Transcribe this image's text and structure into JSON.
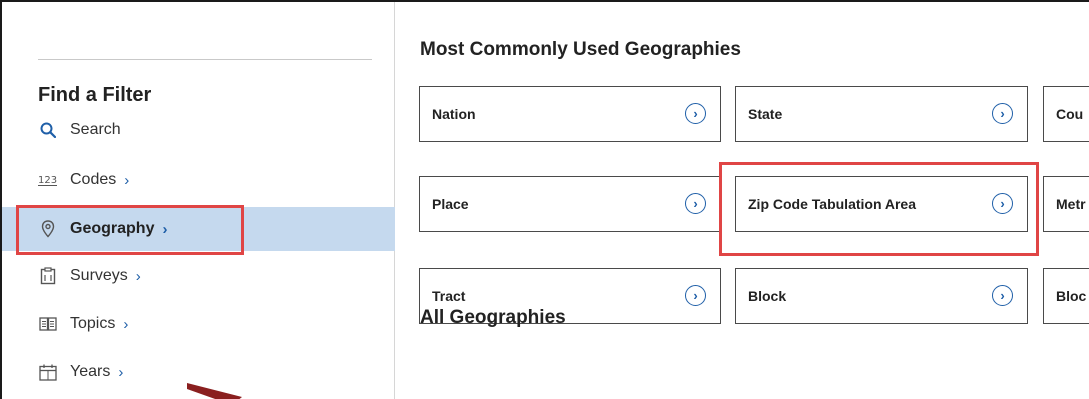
{
  "sidebar": {
    "heading": "Find a Filter",
    "items": [
      {
        "label": "Search",
        "icon": "search-icon"
      },
      {
        "label": "Codes",
        "icon": "codes-123-icon"
      },
      {
        "label": "Geography",
        "icon": "map-pin-icon",
        "selected": true
      },
      {
        "label": "Surveys",
        "icon": "clipboard-icon"
      },
      {
        "label": "Topics",
        "icon": "book-icon"
      },
      {
        "label": "Years",
        "icon": "calendar-icon"
      }
    ]
  },
  "main": {
    "common_heading": "Most Commonly Used Geographies",
    "all_heading": "All Geographies",
    "tiles": [
      {
        "label": "Nation"
      },
      {
        "label": "State"
      },
      {
        "label": "Cou"
      },
      {
        "label": "Place"
      },
      {
        "label": "Zip Code Tabulation Area"
      },
      {
        "label": "Metr"
      },
      {
        "label": "Tract"
      },
      {
        "label": "Block"
      },
      {
        "label": "Bloc"
      }
    ]
  },
  "colors": {
    "accent": "#1f5fa8",
    "selected_bg": "#c5d9ee",
    "highlight": "#e04545"
  }
}
